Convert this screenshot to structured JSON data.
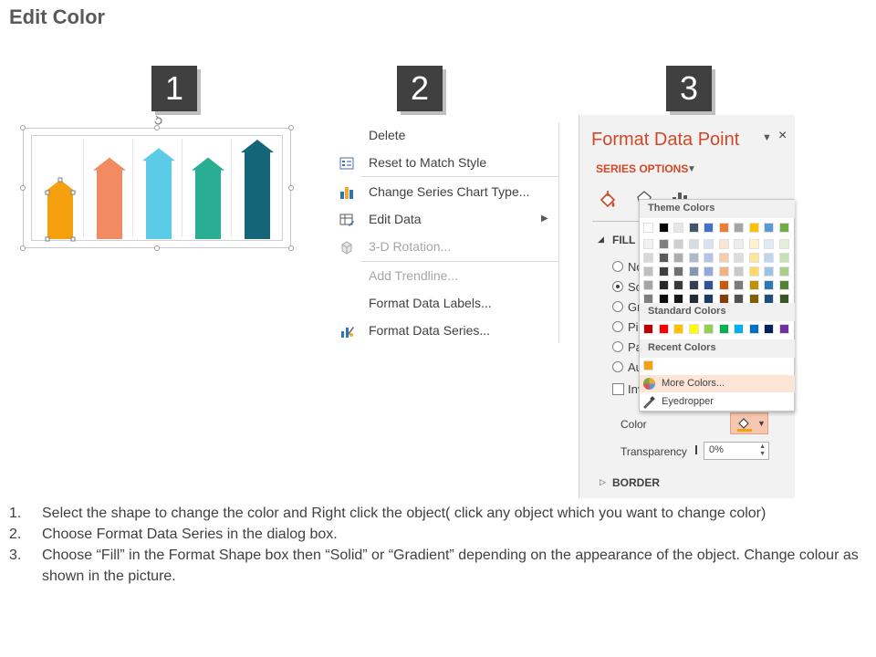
{
  "page": {
    "title": "Edit Color"
  },
  "steps": [
    "1",
    "2",
    "3"
  ],
  "chart": {
    "arrows": [
      {
        "color": "#f5a00f",
        "level": 0.56,
        "selected": true
      },
      {
        "color": "#f28a63",
        "level": 0.77
      },
      {
        "color": "#5bcbe8",
        "level": 0.86
      },
      {
        "color": "#2aae93",
        "level": 0.77
      },
      {
        "color": "#146577",
        "level": 0.94
      }
    ]
  },
  "context_menu": {
    "items": [
      {
        "label": "Delete",
        "icon": "none",
        "disabled": false
      },
      {
        "label": "Reset to Match Style",
        "icon": "reset-style-icon",
        "disabled": false
      },
      {
        "label": "Change Series Chart Type...",
        "icon": "bar-chart-icon",
        "disabled": false
      },
      {
        "label": "Edit Data",
        "icon": "table-edit-icon",
        "disabled": false,
        "submenu": true
      },
      {
        "label": "3-D Rotation...",
        "icon": "cube-icon",
        "disabled": true
      },
      {
        "label": "Add Trendline...",
        "icon": "none",
        "disabled": true
      },
      {
        "label": "Format Data Labels...",
        "icon": "none",
        "disabled": false
      },
      {
        "label": "Format Data Series...",
        "icon": "format-series-icon",
        "disabled": false
      }
    ]
  },
  "format_panel": {
    "title": "Format Data Point",
    "series_options": "SERIES OPTIONS",
    "fill_heading": "FILL",
    "radio_labels": [
      "No",
      "So",
      "Gr",
      "Pic",
      "Pa",
      "Au"
    ],
    "checkbox_label": "Inv",
    "color_label": "Color",
    "transparency_label": "Transparency",
    "transparency_value": "0%",
    "border_heading": "BORDER",
    "close_glyph": "×",
    "pin_glyph": "▼"
  },
  "color_dropdown": {
    "theme_colors_label": "Theme Colors",
    "standard_colors_label": "Standard Colors",
    "recent_colors_label": "Recent Colors",
    "more_colors_label": "More Colors...",
    "eyedropper_label": "Eyedropper",
    "theme_top_row": [
      "#ffffff",
      "#000000",
      "#e7e6e6",
      "#44546a",
      "#4472c4",
      "#ed7d31",
      "#a5a5a5",
      "#ffc000",
      "#5b9bd5",
      "#70ad47"
    ],
    "theme_shades": [
      [
        "#f2f2f2",
        "#7f7f7f",
        "#d0cece",
        "#d6dce4",
        "#d9e2f3",
        "#fbe5d5",
        "#ededed",
        "#fff2cc",
        "#deebf6",
        "#e2efd9"
      ],
      [
        "#d8d8d8",
        "#595959",
        "#aeabab",
        "#adb9ca",
        "#b4c6e7",
        "#f7cbac",
        "#dbdbdb",
        "#fee599",
        "#bdd7ee",
        "#c5e0b3"
      ],
      [
        "#bfbfbf",
        "#3f3f3f",
        "#757070",
        "#8496b0",
        "#8eaadb",
        "#f4b183",
        "#c9c9c9",
        "#ffd965",
        "#9dc3e6",
        "#a8d08d"
      ],
      [
        "#a5a5a5",
        "#262626",
        "#3a3838",
        "#323f4f",
        "#2f5496",
        "#c55a11",
        "#7b7b7b",
        "#bf9000",
        "#2e75b5",
        "#538135"
      ],
      [
        "#7f7f7f",
        "#0c0c0c",
        "#171616",
        "#222a35",
        "#1f3864",
        "#833c0b",
        "#525252",
        "#7f6000",
        "#1e4e79",
        "#375623"
      ]
    ],
    "standard_colors": [
      "#c00000",
      "#ff0000",
      "#ffc000",
      "#ffff00",
      "#92d050",
      "#00b050",
      "#00b0f0",
      "#0070c0",
      "#002060",
      "#7030a0"
    ],
    "recent_colors": [
      "#f5a00f"
    ]
  },
  "instructions": [
    {
      "num": "1.",
      "text": "Select the shape to change the color and Right click the object( click any object which you want to change color)"
    },
    {
      "num": "2.",
      "text": "Choose Format Data Series in the dialog box."
    },
    {
      "num": "3.",
      "text": "Choose “Fill” in the Format Shape box then “Solid” or “Gradient” depending on the appearance of the object. Change colour as shown in the picture."
    }
  ]
}
